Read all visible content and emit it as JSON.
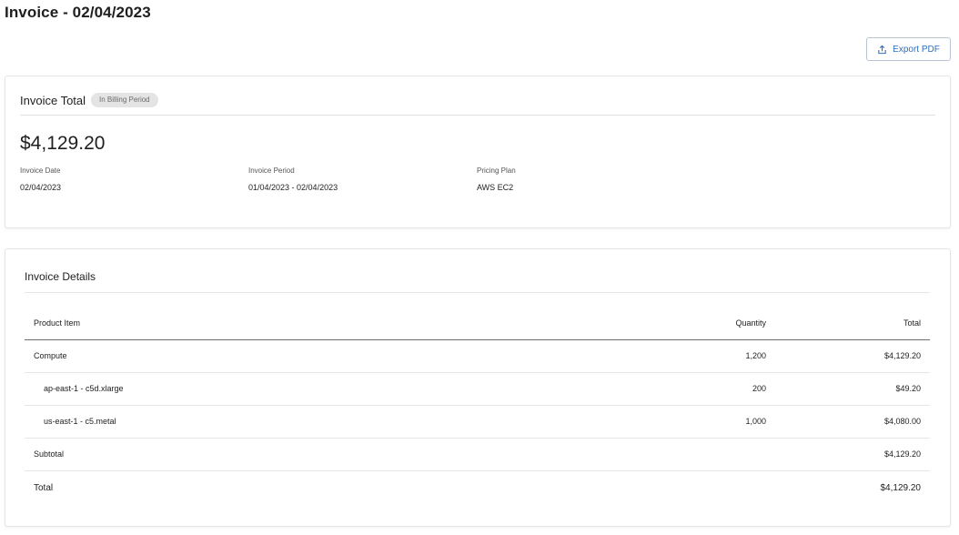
{
  "page": {
    "title": "Invoice - 02/04/2023"
  },
  "toolbar": {
    "export_label": "Export PDF",
    "export_icon": "upload-icon"
  },
  "summary": {
    "title": "Invoice Total",
    "badge": "In Billing Period",
    "amount": "$4,129.20",
    "fields": {
      "invoice_date": {
        "label": "Invoice Date",
        "value": "02/04/2023"
      },
      "invoice_period": {
        "label": "Invoice Period",
        "value": "01/04/2023 - 02/04/2023"
      },
      "pricing_plan": {
        "label": "Pricing Plan",
        "value": "AWS EC2"
      }
    }
  },
  "details": {
    "title": "Invoice Details",
    "columns": {
      "product": "Product Item",
      "quantity": "Quantity",
      "total": "Total"
    },
    "rows": [
      {
        "product": "Compute",
        "quantity": "1,200",
        "total": "$4,129.20"
      },
      {
        "product": "ap-east-1 - c5d.xlarge",
        "quantity": "200",
        "total": "$49.20"
      },
      {
        "product": "us-east-1 - c5.metal",
        "quantity": "1,000",
        "total": "$4,080.00"
      }
    ],
    "subtotal": {
      "label": "Subtotal",
      "value": "$4,129.20"
    },
    "total": {
      "label": "Total",
      "value": "$4,129.20"
    }
  },
  "colors": {
    "accent": "#2f6fbd",
    "badge_bg": "#e4e4e4"
  }
}
